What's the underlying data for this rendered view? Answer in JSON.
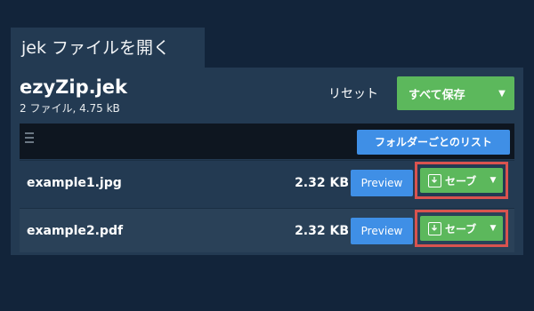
{
  "header": {
    "tab_title": "jek ファイルを開く"
  },
  "archive": {
    "name": "ezyZip.jek",
    "meta": "2 ファイル, 4.75 kB"
  },
  "actions": {
    "reset_label": "リセット",
    "save_all_label": "すべて保存",
    "folder_list_label": "フォルダーごとのリスト"
  },
  "files": [
    {
      "name": "example1.jpg",
      "size": "2.32 KB",
      "preview_label": "Preview",
      "save_label": "セーブ"
    },
    {
      "name": "example2.pdf",
      "size": "2.32 KB",
      "preview_label": "Preview",
      "save_label": "セーブ"
    }
  ],
  "colors": {
    "background": "#12243a",
    "panel": "#233a52",
    "save_green": "#5cb85c",
    "preview_blue": "#3f8fe6",
    "highlight_red": "#d9534f"
  },
  "icons": {
    "menu": "hamburger-icon",
    "download": "download-icon",
    "caret": "caret-down-icon"
  }
}
